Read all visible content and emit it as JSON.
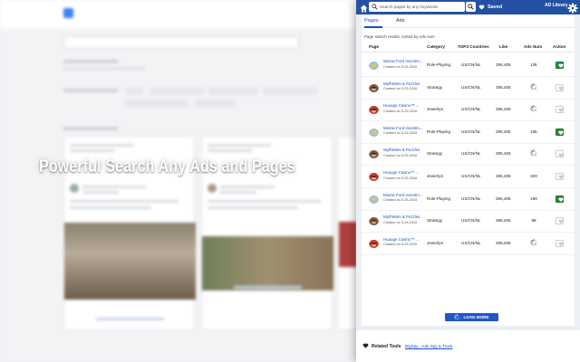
{
  "headline": "Powerful Search Any Ads and Pages",
  "panel": {
    "search": {
      "placeholder": "Search pages by any keywords"
    },
    "saved_label": "Saved",
    "library_label": "AD Library",
    "tabs": [
      {
        "label": "Pages",
        "active": true
      },
      {
        "label": "Ads",
        "active": false
      }
    ],
    "description": "Page search results, sorted by Ads num",
    "columns": [
      "Page",
      "Category",
      "TOP3 Countries",
      "Like",
      "Ads Num",
      "Action"
    ],
    "rows": [
      {
        "name": "Minnie Ford Investm...",
        "created": "Created on 5-25-2016",
        "category": "Role-Playing",
        "countries": "US/CN/NL",
        "like": "295,405",
        "ads": "10k",
        "loading": false,
        "saved": true,
        "avatar": "blonde"
      },
      {
        "name": "MythWars & Puzzles",
        "created": "Created on 5-25-2016",
        "category": "Strategy",
        "countries": "US/CN/NL",
        "like": "295,405",
        "ads": "",
        "loading": true,
        "saved": false,
        "avatar": "warrior"
      },
      {
        "name": "Huuuge Casino™ ...",
        "created": "Created on 5-25-2016",
        "category": "Jewelrys",
        "countries": "US/CN/NL",
        "like": "295,405",
        "ads": "",
        "loading": true,
        "saved": false,
        "avatar": "red"
      },
      {
        "name": "Minnie Ford Investm...",
        "created": "Created on 5-25-2016",
        "category": "Role-Playing",
        "countries": "US/CN/NL",
        "like": "295,405",
        "ads": "10k",
        "loading": false,
        "saved": true,
        "avatar": "blonde"
      },
      {
        "name": "MythWars & Puzzles",
        "created": "Created on 5-25-2016",
        "category": "Strategy",
        "countries": "US/CN/NL",
        "like": "295,405",
        "ads": "",
        "loading": true,
        "saved": false,
        "avatar": "warrior"
      },
      {
        "name": "Huuuge Casino™ ...",
        "created": "Created on 5-25-2016",
        "category": "Jewelrys",
        "countries": "US/CN/NL",
        "like": "295,405",
        "ads": "320",
        "loading": false,
        "saved": false,
        "avatar": "red"
      },
      {
        "name": "Minnie Ford Investm...",
        "created": "Created on 5-25-2016",
        "category": "Role-Playing",
        "countries": "US/CN/NL",
        "like": "295,405",
        "ads": "190",
        "loading": false,
        "saved": true,
        "avatar": "blonde"
      },
      {
        "name": "MythWars & Puzzles",
        "created": "Created on 5-25-2016",
        "category": "Strategy",
        "countries": "US/CN/NL",
        "like": "295,405",
        "ads": "98",
        "loading": false,
        "saved": false,
        "avatar": "warrior"
      },
      {
        "name": "Huuuge Casino™ ...",
        "created": "Created on 5-25-2016",
        "category": "Jewelrys",
        "countries": "US/CN/NL",
        "like": "295,405",
        "ads": "",
        "loading": true,
        "saved": false,
        "avatar": "red"
      }
    ],
    "load_more_label": "LOAD MORE",
    "related": {
      "label": "Related Tools",
      "link": "BigSpy - Ads Spy & Track"
    }
  },
  "colors": {
    "header": "#2450a3",
    "accent": "#1a50c0",
    "saved_green": "#2b8a3e",
    "button": "#2157c4"
  }
}
